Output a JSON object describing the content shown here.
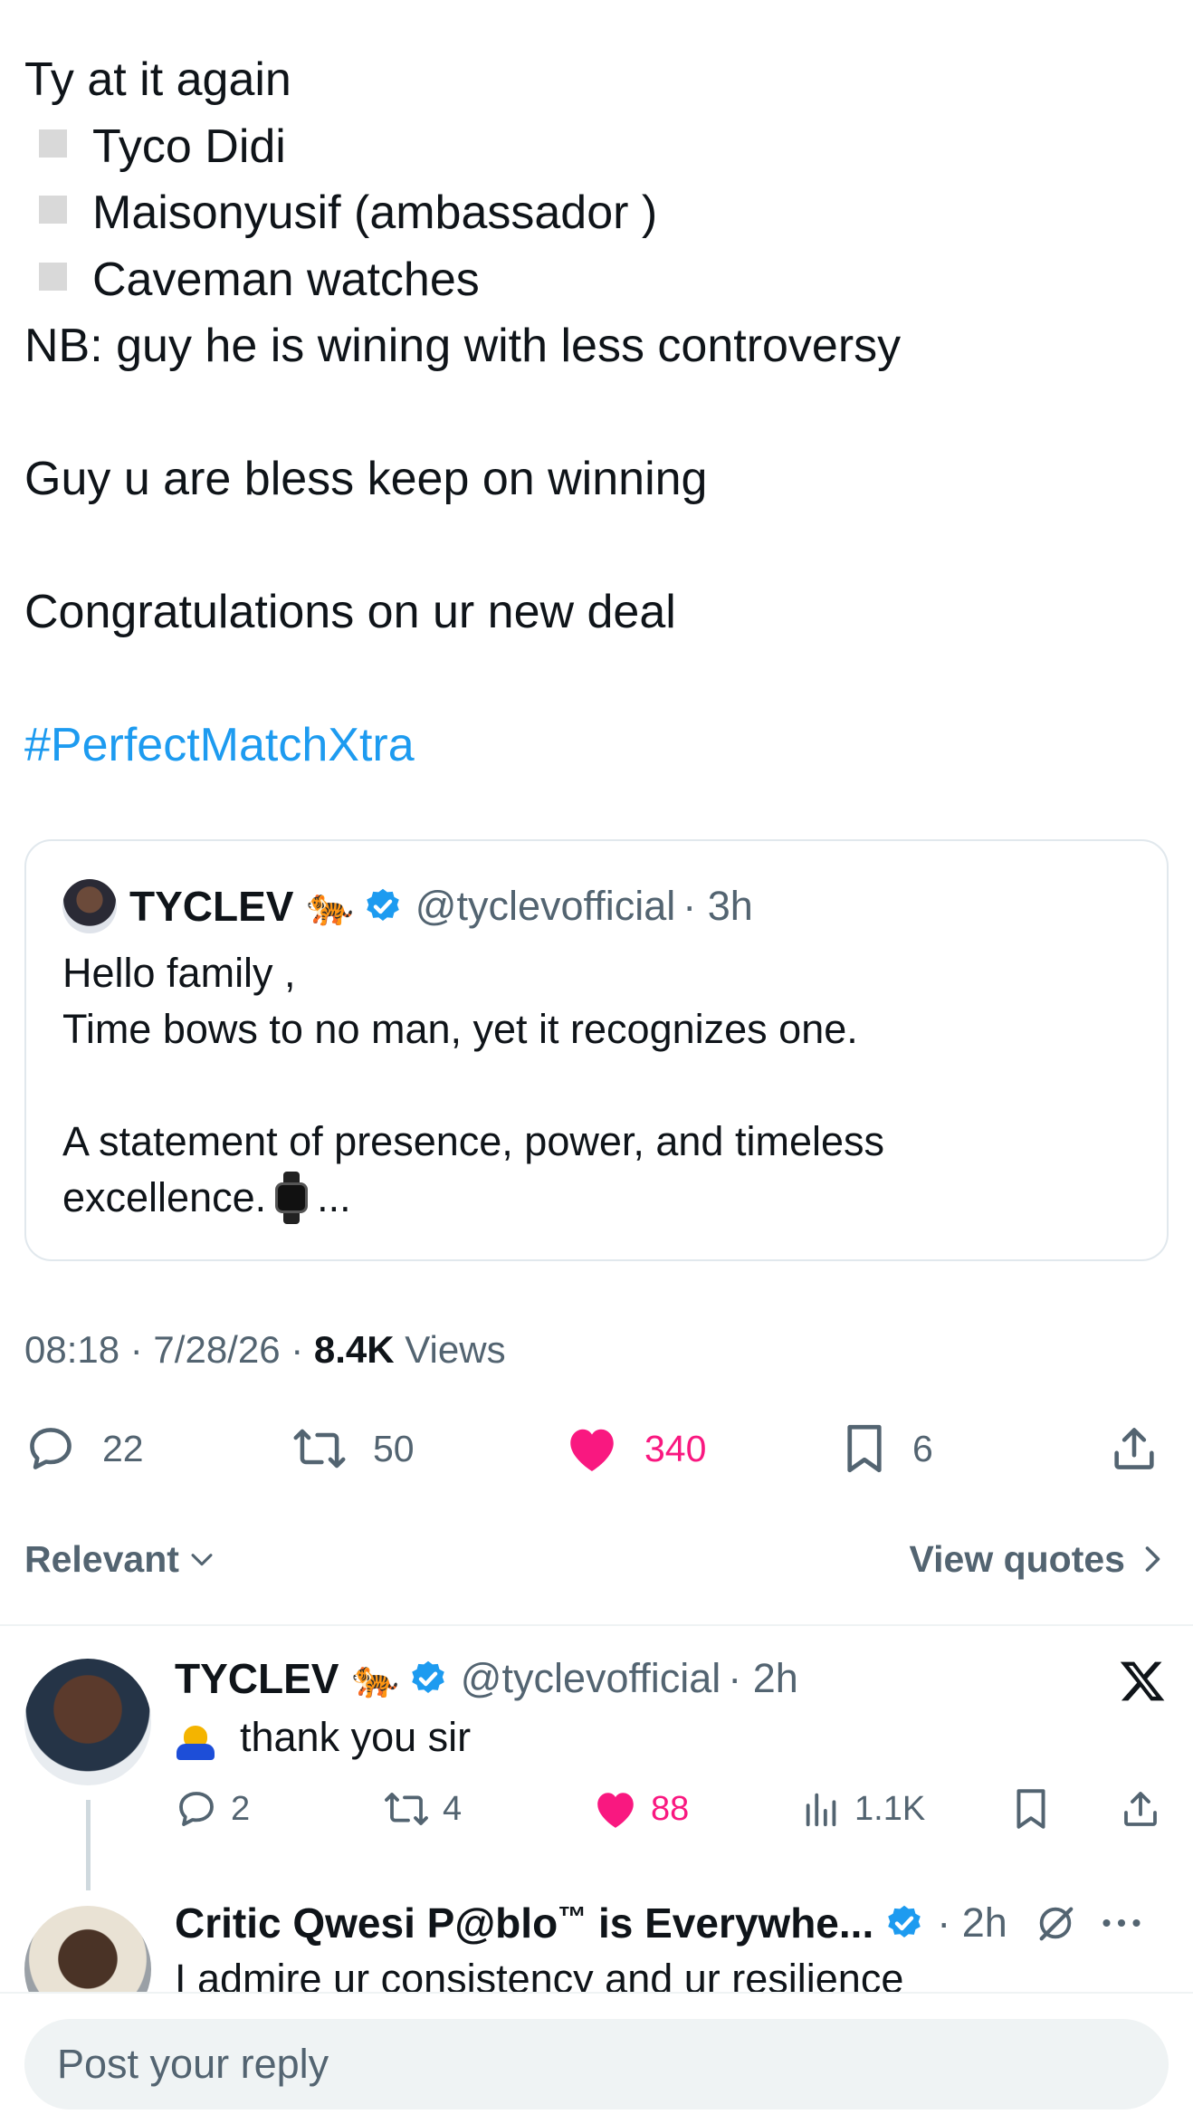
{
  "post": {
    "intro": "Ty at it again",
    "bullets": [
      "Tyco Didi",
      "Maisonyusif (ambassador )",
      "Caveman watches"
    ],
    "nb": "NB: guy he is wining with less controversy",
    "line2": "Guy u are bless keep on winning",
    "line3": "Congratulations on ur new deal",
    "hashtag": "#PerfectMatchXtra"
  },
  "quote": {
    "name": "TYCLEV",
    "emoji": "🐅",
    "handle": "@tyclevofficial",
    "time": "· 3h",
    "line1": "Hello family ,",
    "line2": "Time bows to no man, yet it recognizes one.",
    "line3": "A statement of presence, power, and timeless",
    "line4": "excellence.",
    "ellipsis": "..."
  },
  "meta": {
    "time": "08:18",
    "date": "· 7/28/26 ·",
    "views_count": "8.4K",
    "views_label": "Views"
  },
  "actions": {
    "replies": "22",
    "reposts": "50",
    "likes": "340",
    "bookmarks": "6"
  },
  "sort": {
    "relevant": "Relevant",
    "view_quotes": "View quotes"
  },
  "replies": [
    {
      "name": "TYCLEV",
      "emoji": "🐅",
      "handle": "@tyclevofficial",
      "time": "· 2h",
      "text": "thank you sir",
      "replies": "2",
      "reposts": "4",
      "likes": "88",
      "views": "1.1K"
    },
    {
      "name": "Critic Qwesi P@blo",
      "tm": "™",
      "name_suffix": " is Everywhe...",
      "time": "· 2h",
      "text": "I admire ur consistency and ur resilience"
    }
  ],
  "reply_bar": {
    "placeholder": "Post your reply"
  },
  "colors": {
    "link": "#1d9bf0",
    "like": "#f91880",
    "muted": "#536471",
    "text": "#0f1419"
  }
}
